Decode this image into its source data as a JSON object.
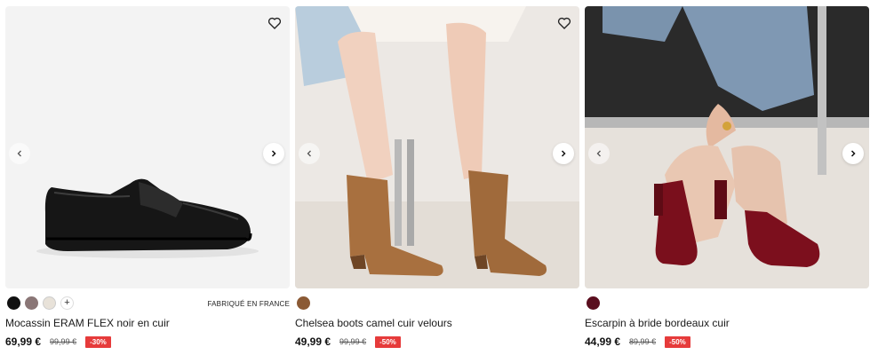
{
  "products": [
    {
      "title": "Mocassin ERAM FLEX noir en cuir",
      "price": "69,99 €",
      "old_price": "99,99 €",
      "discount": "-30%",
      "made_in": "FABRIQUÉ EN FRANCE",
      "more_colors": "+",
      "swatches": [
        "#111111",
        "#8a7676",
        "#e8e2d9"
      ]
    },
    {
      "title": "Chelsea boots camel cuir velours",
      "price": "49,99 €",
      "old_price": "99,99 €",
      "discount": "-50%",
      "swatches": [
        "#8b5a35"
      ]
    },
    {
      "title": "Escarpin à bride bordeaux cuir",
      "price": "44,99 €",
      "old_price": "89,99 €",
      "discount": "-50%",
      "swatches": [
        "#5a0e1e"
      ]
    }
  ],
  "icons": {
    "heart": "heart-icon",
    "prev": "chevron-left-icon",
    "next": "chevron-right-icon"
  },
  "colors": {
    "badge": "#e63b3b",
    "image_bg": "#f2f2f2"
  }
}
